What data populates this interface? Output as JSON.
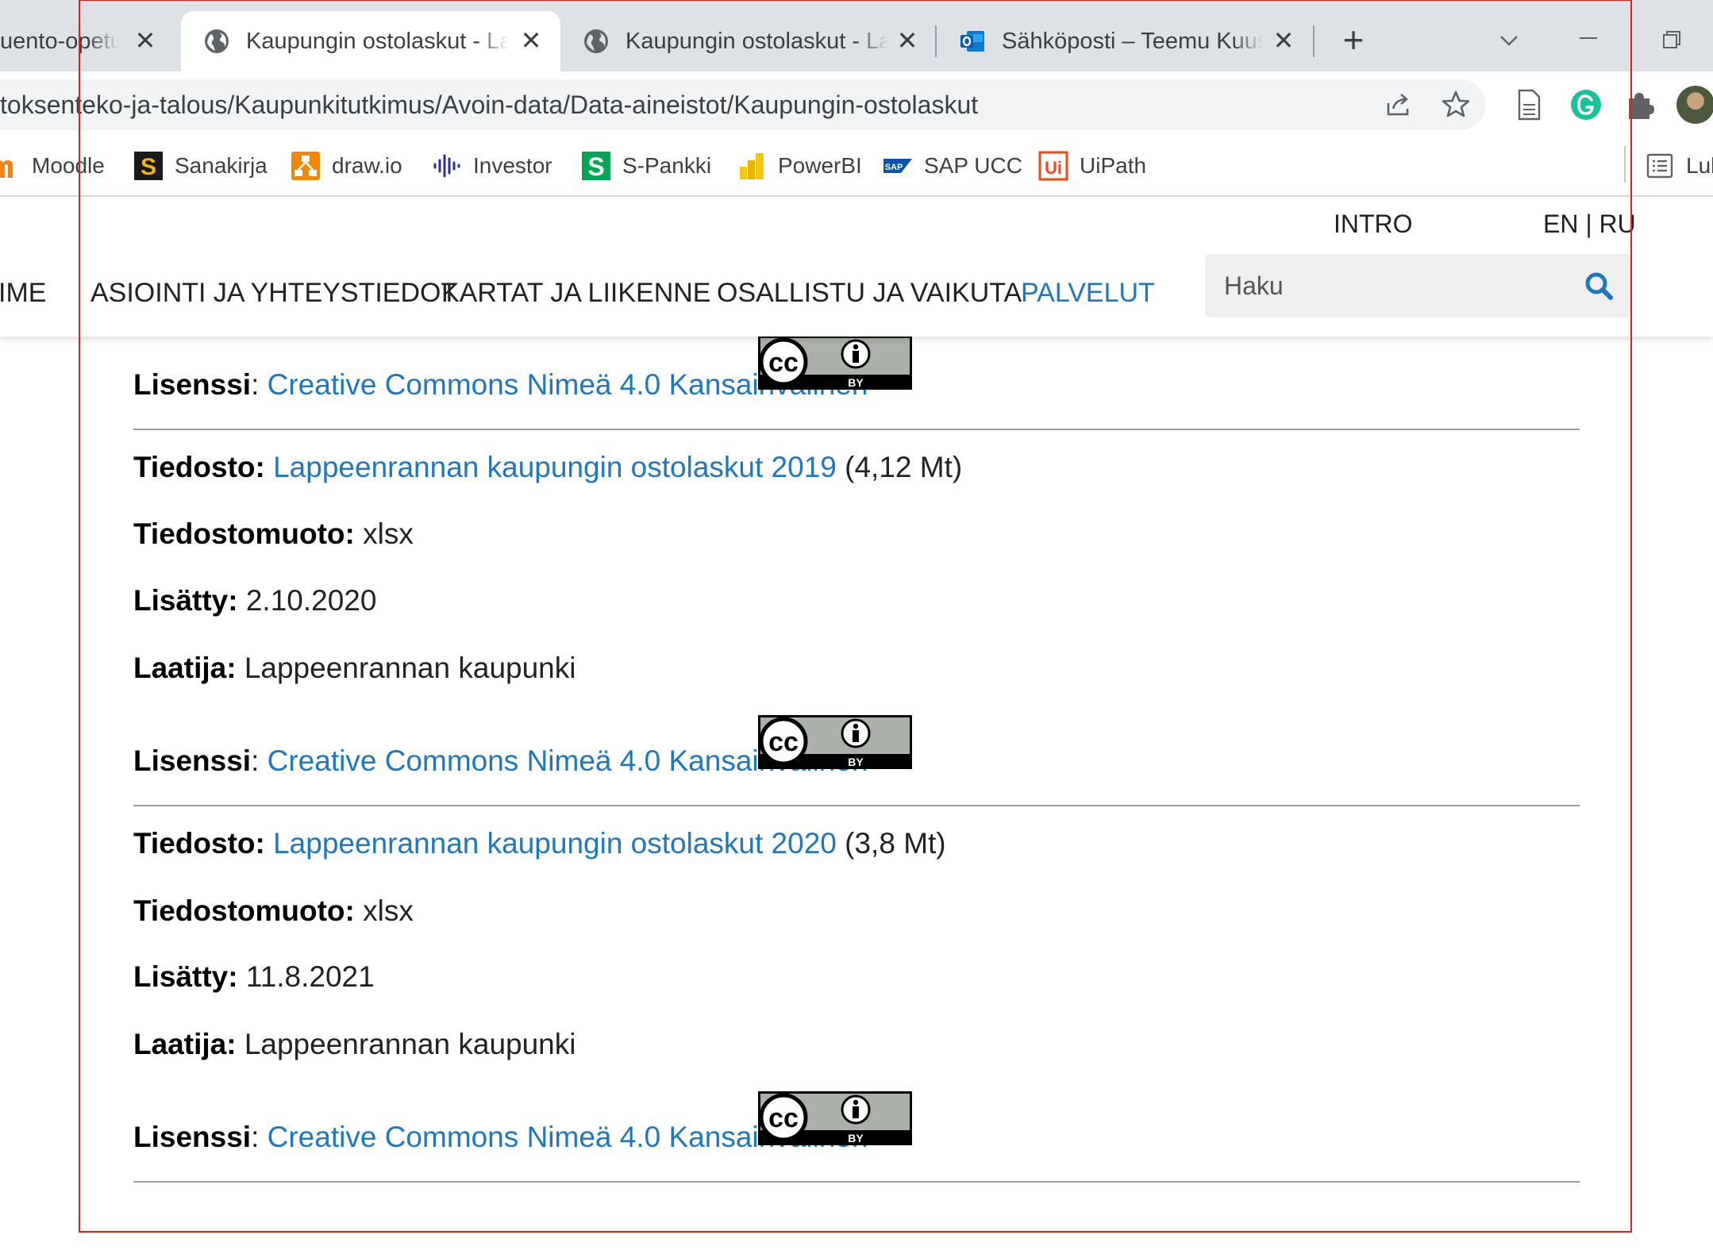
{
  "browser": {
    "tabs": [
      {
        "title": "uento-opetus",
        "active": false
      },
      {
        "title": "Kaupungin ostolaskut - Lappeenranta",
        "active": true
      },
      {
        "title": "Kaupungin ostolaskut - Lappeenranta",
        "active": false
      },
      {
        "title": "Sähköposti – Teemu Kuusisto",
        "active": false
      }
    ],
    "close_glyph": "✕",
    "new_tab_glyph": "+",
    "url": "toksenteko-ja-talous/Kaupunkitutkimus/Avoin-data/Data-aineistot/Kaupungin-ostolaskut",
    "bookmarks": [
      "Moodle",
      "Sanakirja",
      "draw.io",
      "Investor",
      "S-Pankki",
      "PowerBI",
      "SAP UCC",
      "UiPath",
      "Luk"
    ],
    "colors": {
      "tabstrip": "#dee1e6",
      "omnibox": "#f1f3f4",
      "grammarly": "#15c39a"
    }
  },
  "site": {
    "top_links": {
      "intro": "INTRO",
      "lang": "EN | RU"
    },
    "nav": [
      "IME",
      "ASIOINTI JA YHTEYSTIEDOT",
      "KARTAT JA LIIKENNE",
      "OSALLISTU JA VAIKUTA",
      "PALVELUT"
    ],
    "search": {
      "placeholder": "Haku"
    },
    "link_color": "#1e77c1"
  },
  "content": {
    "labels": {
      "license": "Lisenssi",
      "file": "Tiedosto:",
      "format": "Tiedostomuoto:",
      "added": "Lisätty:",
      "author": "Laatija:"
    },
    "license_link": "Creative Commons Nimeä 4.0 Kansainvälinen",
    "cc_badge": {
      "cc": "cc",
      "by": "BY"
    },
    "files": [
      {
        "name": "Lappeenrannan kaupungin ostolaskut 2019",
        "size": "(4,12 Mt)",
        "format": "xlsx",
        "added": "2.10.2020",
        "author": "Lappeenrannan kaupunki"
      },
      {
        "name": "Lappeenrannan kaupungin ostolaskut 2020",
        "size": "(3,8 Mt)",
        "format": "xlsx",
        "added": "11.8.2021",
        "author": "Lappeenrannan kaupunki"
      }
    ]
  }
}
